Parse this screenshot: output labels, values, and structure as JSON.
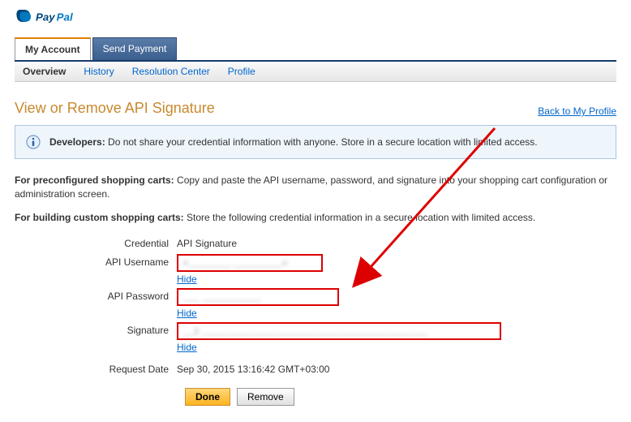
{
  "brand": "PayPal",
  "tabs": {
    "my_account": "My Account",
    "send_payment": "Send Payment"
  },
  "subnav": {
    "overview": "Overview",
    "history": "History",
    "resolution": "Resolution Center",
    "profile": "Profile"
  },
  "page_title": "View or Remove API Signature",
  "back_link": "Back to My Profile",
  "info": {
    "bold": "Developers:",
    "text": " Do not share your credential information with anyone. Store in a secure location with limited access."
  },
  "para1": {
    "bold": "For preconfigured shopping carts:",
    "text": " Copy and paste the API username, password, and signature into your shopping cart configuration or administration screen."
  },
  "para2": {
    "bold": "For building custom shopping carts:",
    "text": " Store the following credential information in a secure location with limited access."
  },
  "labels": {
    "credential": "Credential",
    "api_username": "API Username",
    "api_password": "API Password",
    "signature": "Signature",
    "request_date": "Request Date"
  },
  "values": {
    "credential": "API Signature",
    "api_username_masked": "v________._________u",
    "api_password_masked": "___  ___________",
    "signature_masked": "__||  __________________________________________",
    "request_date": "Sep 30, 2015 13:16:42 GMT+03:00"
  },
  "hide_label": "Hide",
  "buttons": {
    "done": "Done",
    "remove": "Remove"
  },
  "colors": {
    "accent": "#c88a2e",
    "link": "#0066cc",
    "highlight_border": "#d00",
    "arrow": "#d00"
  }
}
